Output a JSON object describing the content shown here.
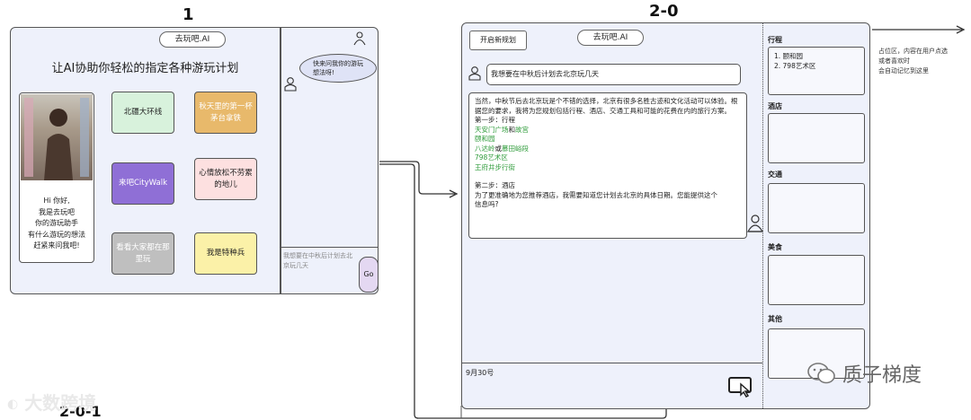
{
  "frame1": {
    "label": "1",
    "app_title": "去玩吧.AI",
    "headline": "让AI协助你轻松的指定各种游玩计划",
    "intro_card": {
      "lines": [
        "Hi 你好,",
        "我是去玩吧",
        "你的游玩助手",
        "有什么游玩的想法",
        "赶紧来问我吧!"
      ]
    },
    "tiles": [
      {
        "label": "北疆大环线",
        "color": "#d8f2dc"
      },
      {
        "label": "秋天里的第一杯茅台拿铁",
        "color": "#e8b96b"
      },
      {
        "label": "来吧CityWalk",
        "color": "#8f6fd6"
      },
      {
        "label": "心情放松不劳累的地儿",
        "color": "#fde0e0"
      },
      {
        "label": "看看大家都在那里玩",
        "color": "#bfbfbf"
      },
      {
        "label": "我是特种兵",
        "color": "#fbf1a8"
      }
    ],
    "bubble_text": "快来问我你的游玩想法呀!",
    "input_text": "我想要在中秋后计划去北京玩几天",
    "go_label": "Go"
  },
  "frame2": {
    "label": "2-0",
    "new_plan_button": "开启新规划",
    "app_title": "去玩吧.AI",
    "user_message": "我想要在中秋后计划去北京玩几天",
    "ai_reply": {
      "intro": "当然，中秋节后去北京玩是个不错的选择，北京有很多名胜古迹和文化活动可以体验。根据您的要求，我将为您规划包括行程、酒店、交通工具和可能的花费在内的旅行方案。",
      "step1_title": "第一步：行程",
      "step1_lines": [
        {
          "a": "天安门广场",
          "sep": "和",
          "b": "故宫"
        },
        {
          "a": "颐和园",
          "sep": "",
          "b": ""
        },
        {
          "a": "八达岭",
          "sep": "或",
          "b": "慕田峪段"
        },
        {
          "a": "798艺术区",
          "sep": "",
          "b": ""
        },
        {
          "a": "王府井步行街",
          "sep": "",
          "b": ""
        }
      ],
      "step2_title": "第二步：酒店",
      "step2_text": "为了更准确地为您推荐酒店，我需要知道您计划去北京的具体日期。您能提供这个信息吗?"
    },
    "date_input": "9月30号",
    "sections": [
      {
        "title": "行程",
        "items": [
          "1. 颐和园",
          "2. 798艺术区"
        ]
      },
      {
        "title": "酒店",
        "items": []
      },
      {
        "title": "交通",
        "items": []
      },
      {
        "title": "美食",
        "items": []
      },
      {
        "title": "其他",
        "items": []
      }
    ]
  },
  "annotation": {
    "lines": [
      "占位区，内容在用户点选",
      "或者喜欢时",
      "会自动记忆到这里"
    ]
  },
  "frame3": {
    "label": "2-0-1"
  },
  "watermarks": {
    "left": "大数跨境",
    "right": "质子梯度"
  },
  "colors": {
    "panel_bg": "#eef1fb",
    "green_text": "#2e9b3a"
  }
}
